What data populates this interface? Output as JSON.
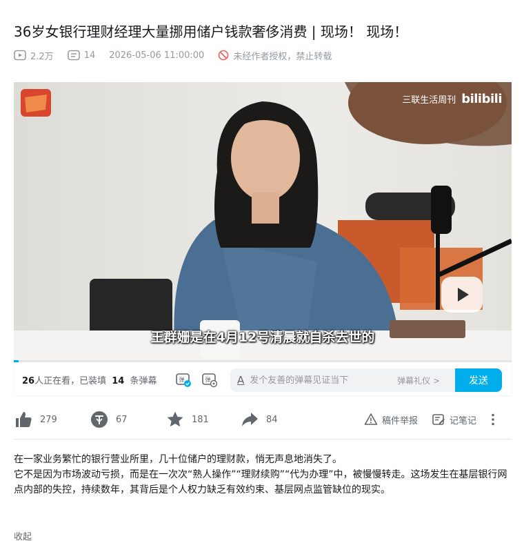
{
  "video": {
    "title": "36岁女银行理财经理大量挪用储户钱款奢侈消费 | 现场！ 现场！",
    "views": "2.2万",
    "danmaku_count": "14",
    "datetime": "2026-05-06 11:00:00",
    "copyright_notice": "未经作者授权，禁止转载"
  },
  "player": {
    "subtitle": "王群姗是在4月12号清晨就自杀去世的",
    "watermark_channel": "三联生活周刊",
    "watermark_logo": "bilibili",
    "progress_fraction": 0.01
  },
  "danmaku_bar": {
    "watching_count": "26",
    "watching_suffix": "人正在看，已装填",
    "loaded_count": "14",
    "loaded_suffix": "条弹幕",
    "input_placeholder": "发个友善的弹幕见证当下",
    "etiquette_label": "弹幕礼仪 >",
    "send_label": "发送"
  },
  "toolbar": {
    "like_count": "279",
    "coin_count": "67",
    "fav_count": "181",
    "share_count": "84",
    "report_label": "稿件举报",
    "note_label": "记笔记"
  },
  "description": {
    "para1": "在一家业务繁忙的银行营业所里，几十位储户的理财款，悄无声息地消失了。",
    "para2": "它不是因为市场波动亏损，而是在一次次“熟人操作”“理财续购”“代为办理”中，被慢慢转走。这场发生在基层银行网点内部的失控，持续数年，其背后是个人权力缺乏有效约束、基层网点监管缺位的现实。",
    "collapse_label": "收起"
  },
  "colors": {
    "accent": "#00aeec",
    "text_primary": "#18191c",
    "text_secondary": "#61666d",
    "text_meta": "#9499a0",
    "forbid_red": "#f25d59"
  },
  "icons": [
    "play-count-icon",
    "danmaku-icon",
    "forbid-icon",
    "danmaku-toggle-icon",
    "danmaku-settings-icon",
    "like-icon",
    "coin-icon",
    "favorite-icon",
    "share-icon",
    "report-icon",
    "note-icon",
    "more-icon"
  ]
}
